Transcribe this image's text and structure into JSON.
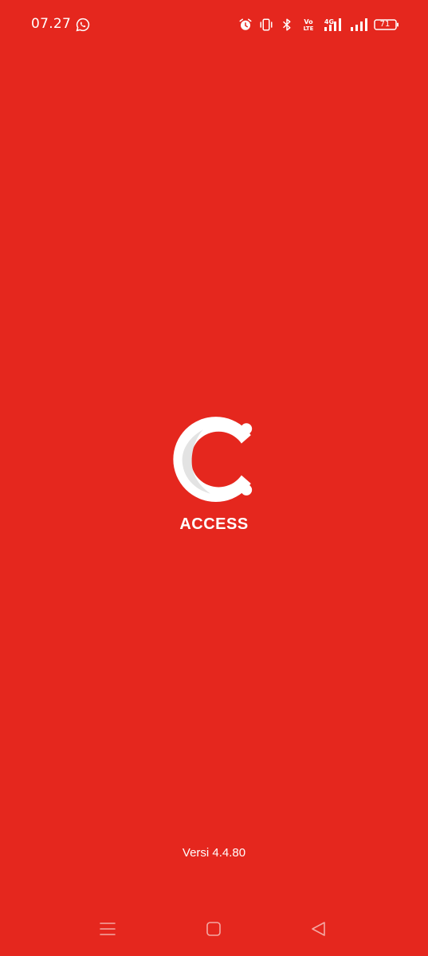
{
  "status_bar": {
    "time": "07.27",
    "battery_level": "71",
    "network": "4G",
    "icons": [
      "whatsapp-icon",
      "alarm-icon",
      "vibrate-icon",
      "bluetooth-icon",
      "volte-icon",
      "signal-4g-icon",
      "signal-icon",
      "battery-icon"
    ]
  },
  "splash": {
    "brand_name": "ACCESS",
    "version": "Versi 4.4.80",
    "background_color": "#E5271E",
    "logo_color": "#FFFFFF"
  },
  "nav_bar": {
    "buttons": [
      "menu-icon",
      "home-icon",
      "back-icon"
    ]
  }
}
